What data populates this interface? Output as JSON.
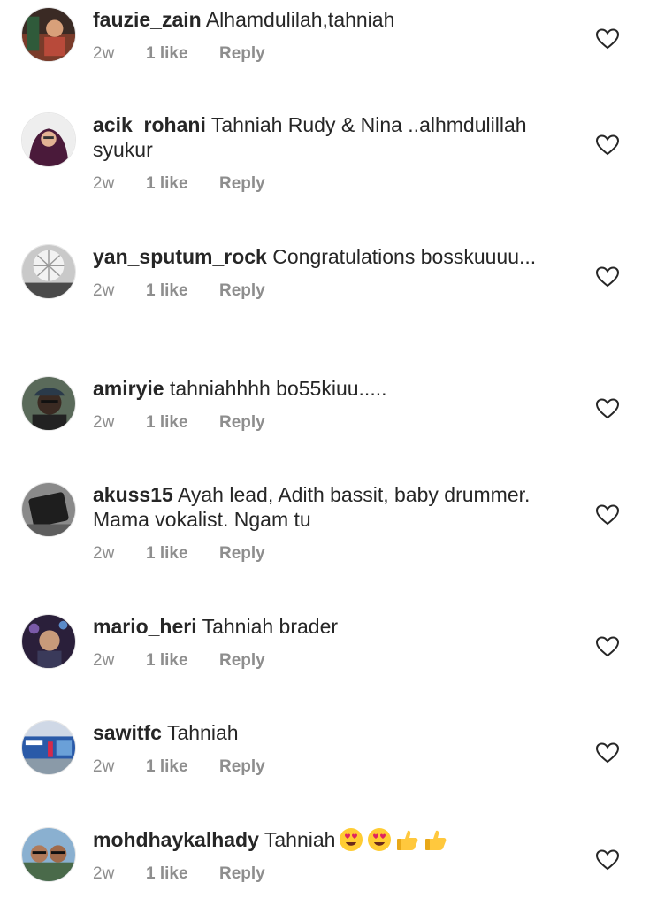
{
  "comments": [
    {
      "username": "fauzie_zain",
      "text": "Alhamdulilah,tahniah",
      "time": "2w",
      "likes": "1 like",
      "reply": "Reply"
    },
    {
      "username": "acik_rohani",
      "text": "Tahniah Rudy & Nina ..alhmdulillah syukur",
      "time": "2w",
      "likes": "1 like",
      "reply": "Reply"
    },
    {
      "username": "yan_sputum_rock",
      "text": "Congratulations bosskuuuu...",
      "time": "2w",
      "likes": "1 like",
      "reply": "Reply"
    },
    {
      "username": "amiryie",
      "text": "tahniahhhh bo55kiuu.....",
      "time": "2w",
      "likes": "1 like",
      "reply": "Reply"
    },
    {
      "username": "akuss15",
      "text": "Ayah lead, Adith bassit, baby drummer. Mama vokalist. Ngam tu",
      "time": "2w",
      "likes": "1 like",
      "reply": "Reply"
    },
    {
      "username": "mario_heri",
      "text": "Tahniah brader",
      "time": "2w",
      "likes": "1 like",
      "reply": "Reply"
    },
    {
      "username": "sawitfc",
      "text": "Tahniah",
      "time": "2w",
      "likes": "1 like",
      "reply": "Reply"
    },
    {
      "username": "mohdhaykalhady",
      "text": "Tahniah",
      "time": "2w",
      "likes": "1 like",
      "reply": "Reply",
      "emojis": [
        "heart-eyes-emoji",
        "heart-eyes-emoji",
        "thumbs-up-emoji",
        "thumbs-up-emoji"
      ]
    }
  ],
  "colors": {
    "text": "#262626",
    "meta": "#8e8e8e",
    "heart_outline": "#262626",
    "emoji_face": "#ffcc33",
    "emoji_heart": "#e0245e"
  }
}
